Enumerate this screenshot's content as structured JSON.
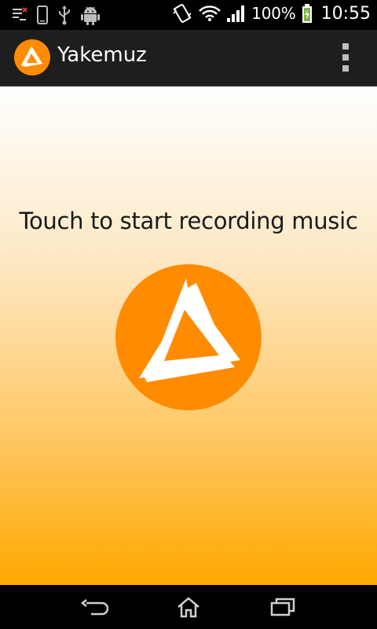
{
  "status_bar": {
    "battery_percent": "100%",
    "time": "10:55",
    "icons": [
      "notification-list-icon",
      "phone-icon",
      "usb-icon",
      "android-debug-icon",
      "vibrate-icon",
      "wifi-icon",
      "signal-icon",
      "battery-charging-icon"
    ]
  },
  "action_bar": {
    "app_title": "Yakemuz",
    "logo_icon": "yakemuz-logo-icon",
    "menu_icon": "overflow-menu-icon"
  },
  "main": {
    "prompt": "Touch to start recording music",
    "record_icon": "yakemuz-record-icon",
    "accent_color": "#ff8c00",
    "gradient_bottom_color": "#ffa800"
  },
  "nav_bar": {
    "icons": [
      "back-icon",
      "home-icon",
      "recent-apps-icon"
    ]
  }
}
